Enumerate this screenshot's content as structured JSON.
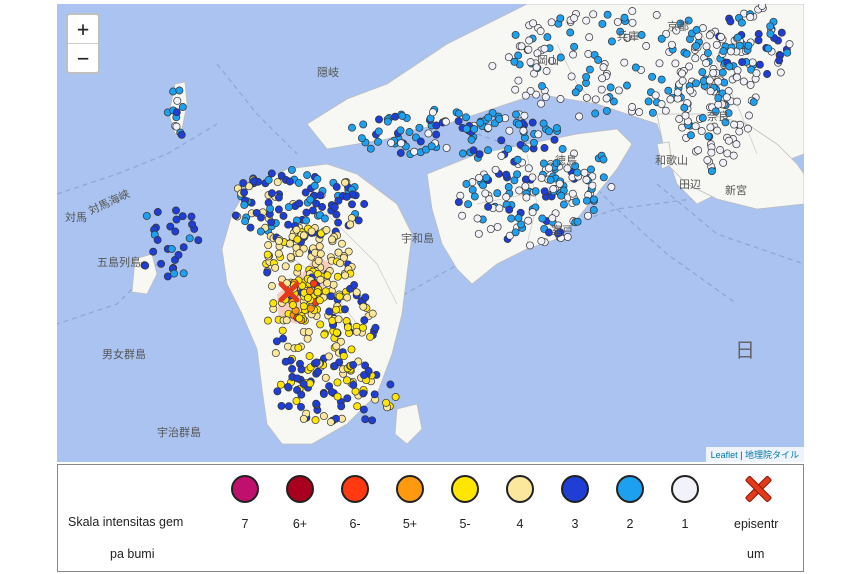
{
  "map": {
    "zoom_in_label": "+",
    "zoom_out_label": "−",
    "attribution_leaflet": "Leaflet",
    "attribution_separator": " | ",
    "attribution_tiles": "地理院タイル",
    "labels": [
      "京都",
      "兵庫",
      "奈良",
      "和歌山",
      "徳島",
      "対馬",
      "五島列島",
      "男女群島",
      "宇治群島",
      "隠岐",
      "日",
      "岡山",
      "田辺",
      "新宮",
      "室戸",
      "宇和島",
      "対馬海峡"
    ],
    "colors": {
      "sea": "#aac3f0",
      "land": "#f7f7f4",
      "border": "#b8b8b8"
    }
  },
  "legend": {
    "title_line1": "Skala intensitas gem",
    "title_line2": "pa bumi",
    "items": [
      {
        "label": "7",
        "color": "#c0106e",
        "icon": "intensity-7-circle"
      },
      {
        "label": "6+",
        "color": "#a8001e",
        "icon": "intensity-6plus-circle"
      },
      {
        "label": "6-",
        "color": "#ff3a10",
        "icon": "intensity-6minus-circle"
      },
      {
        "label": "5+",
        "color": "#ff9a10",
        "icon": "intensity-5plus-circle"
      },
      {
        "label": "5-",
        "color": "#ffe600",
        "icon": "intensity-5minus-circle"
      },
      {
        "label": "4",
        "color": "#fce89c",
        "icon": "intensity-4-circle"
      },
      {
        "label": "3",
        "color": "#1e3ed6",
        "icon": "intensity-3-circle"
      },
      {
        "label": "2",
        "color": "#1ea0f0",
        "icon": "intensity-2-circle"
      },
      {
        "label": "1",
        "color": "#f2f2fa",
        "icon": "intensity-1-circle"
      }
    ],
    "epicenter": {
      "label_line1": "episentr",
      "label_line2": "um",
      "color": "#e53a1a",
      "icon": "epicenter-x-icon"
    }
  }
}
